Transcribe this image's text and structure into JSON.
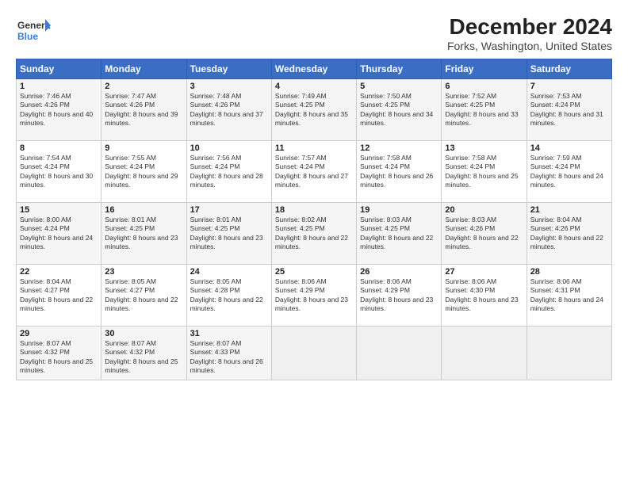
{
  "logo": {
    "line1": "General",
    "line2": "Blue"
  },
  "title": "December 2024",
  "subtitle": "Forks, Washington, United States",
  "days_header": [
    "Sunday",
    "Monday",
    "Tuesday",
    "Wednesday",
    "Thursday",
    "Friday",
    "Saturday"
  ],
  "weeks": [
    [
      {
        "num": "1",
        "rise": "7:46 AM",
        "set": "4:26 PM",
        "daylight": "8 hours and 40 minutes."
      },
      {
        "num": "2",
        "rise": "7:47 AM",
        "set": "4:26 PM",
        "daylight": "8 hours and 39 minutes."
      },
      {
        "num": "3",
        "rise": "7:48 AM",
        "set": "4:26 PM",
        "daylight": "8 hours and 37 minutes."
      },
      {
        "num": "4",
        "rise": "7:49 AM",
        "set": "4:25 PM",
        "daylight": "8 hours and 35 minutes."
      },
      {
        "num": "5",
        "rise": "7:50 AM",
        "set": "4:25 PM",
        "daylight": "8 hours and 34 minutes."
      },
      {
        "num": "6",
        "rise": "7:52 AM",
        "set": "4:25 PM",
        "daylight": "8 hours and 33 minutes."
      },
      {
        "num": "7",
        "rise": "7:53 AM",
        "set": "4:24 PM",
        "daylight": "8 hours and 31 minutes."
      }
    ],
    [
      {
        "num": "8",
        "rise": "7:54 AM",
        "set": "4:24 PM",
        "daylight": "8 hours and 30 minutes."
      },
      {
        "num": "9",
        "rise": "7:55 AM",
        "set": "4:24 PM",
        "daylight": "8 hours and 29 minutes."
      },
      {
        "num": "10",
        "rise": "7:56 AM",
        "set": "4:24 PM",
        "daylight": "8 hours and 28 minutes."
      },
      {
        "num": "11",
        "rise": "7:57 AM",
        "set": "4:24 PM",
        "daylight": "8 hours and 27 minutes."
      },
      {
        "num": "12",
        "rise": "7:58 AM",
        "set": "4:24 PM",
        "daylight": "8 hours and 26 minutes."
      },
      {
        "num": "13",
        "rise": "7:58 AM",
        "set": "4:24 PM",
        "daylight": "8 hours and 25 minutes."
      },
      {
        "num": "14",
        "rise": "7:59 AM",
        "set": "4:24 PM",
        "daylight": "8 hours and 24 minutes."
      }
    ],
    [
      {
        "num": "15",
        "rise": "8:00 AM",
        "set": "4:24 PM",
        "daylight": "8 hours and 24 minutes."
      },
      {
        "num": "16",
        "rise": "8:01 AM",
        "set": "4:25 PM",
        "daylight": "8 hours and 23 minutes."
      },
      {
        "num": "17",
        "rise": "8:01 AM",
        "set": "4:25 PM",
        "daylight": "8 hours and 23 minutes."
      },
      {
        "num": "18",
        "rise": "8:02 AM",
        "set": "4:25 PM",
        "daylight": "8 hours and 22 minutes."
      },
      {
        "num": "19",
        "rise": "8:03 AM",
        "set": "4:25 PM",
        "daylight": "8 hours and 22 minutes."
      },
      {
        "num": "20",
        "rise": "8:03 AM",
        "set": "4:26 PM",
        "daylight": "8 hours and 22 minutes."
      },
      {
        "num": "21",
        "rise": "8:04 AM",
        "set": "4:26 PM",
        "daylight": "8 hours and 22 minutes."
      }
    ],
    [
      {
        "num": "22",
        "rise": "8:04 AM",
        "set": "4:27 PM",
        "daylight": "8 hours and 22 minutes."
      },
      {
        "num": "23",
        "rise": "8:05 AM",
        "set": "4:27 PM",
        "daylight": "8 hours and 22 minutes."
      },
      {
        "num": "24",
        "rise": "8:05 AM",
        "set": "4:28 PM",
        "daylight": "8 hours and 22 minutes."
      },
      {
        "num": "25",
        "rise": "8:06 AM",
        "set": "4:29 PM",
        "daylight": "8 hours and 23 minutes."
      },
      {
        "num": "26",
        "rise": "8:06 AM",
        "set": "4:29 PM",
        "daylight": "8 hours and 23 minutes."
      },
      {
        "num": "27",
        "rise": "8:06 AM",
        "set": "4:30 PM",
        "daylight": "8 hours and 23 minutes."
      },
      {
        "num": "28",
        "rise": "8:06 AM",
        "set": "4:31 PM",
        "daylight": "8 hours and 24 minutes."
      }
    ],
    [
      {
        "num": "29",
        "rise": "8:07 AM",
        "set": "4:32 PM",
        "daylight": "8 hours and 25 minutes."
      },
      {
        "num": "30",
        "rise": "8:07 AM",
        "set": "4:32 PM",
        "daylight": "8 hours and 25 minutes."
      },
      {
        "num": "31",
        "rise": "8:07 AM",
        "set": "4:33 PM",
        "daylight": "8 hours and 26 minutes."
      },
      null,
      null,
      null,
      null
    ]
  ],
  "labels": {
    "sunrise": "Sunrise:",
    "sunset": "Sunset:",
    "daylight": "Daylight:"
  }
}
